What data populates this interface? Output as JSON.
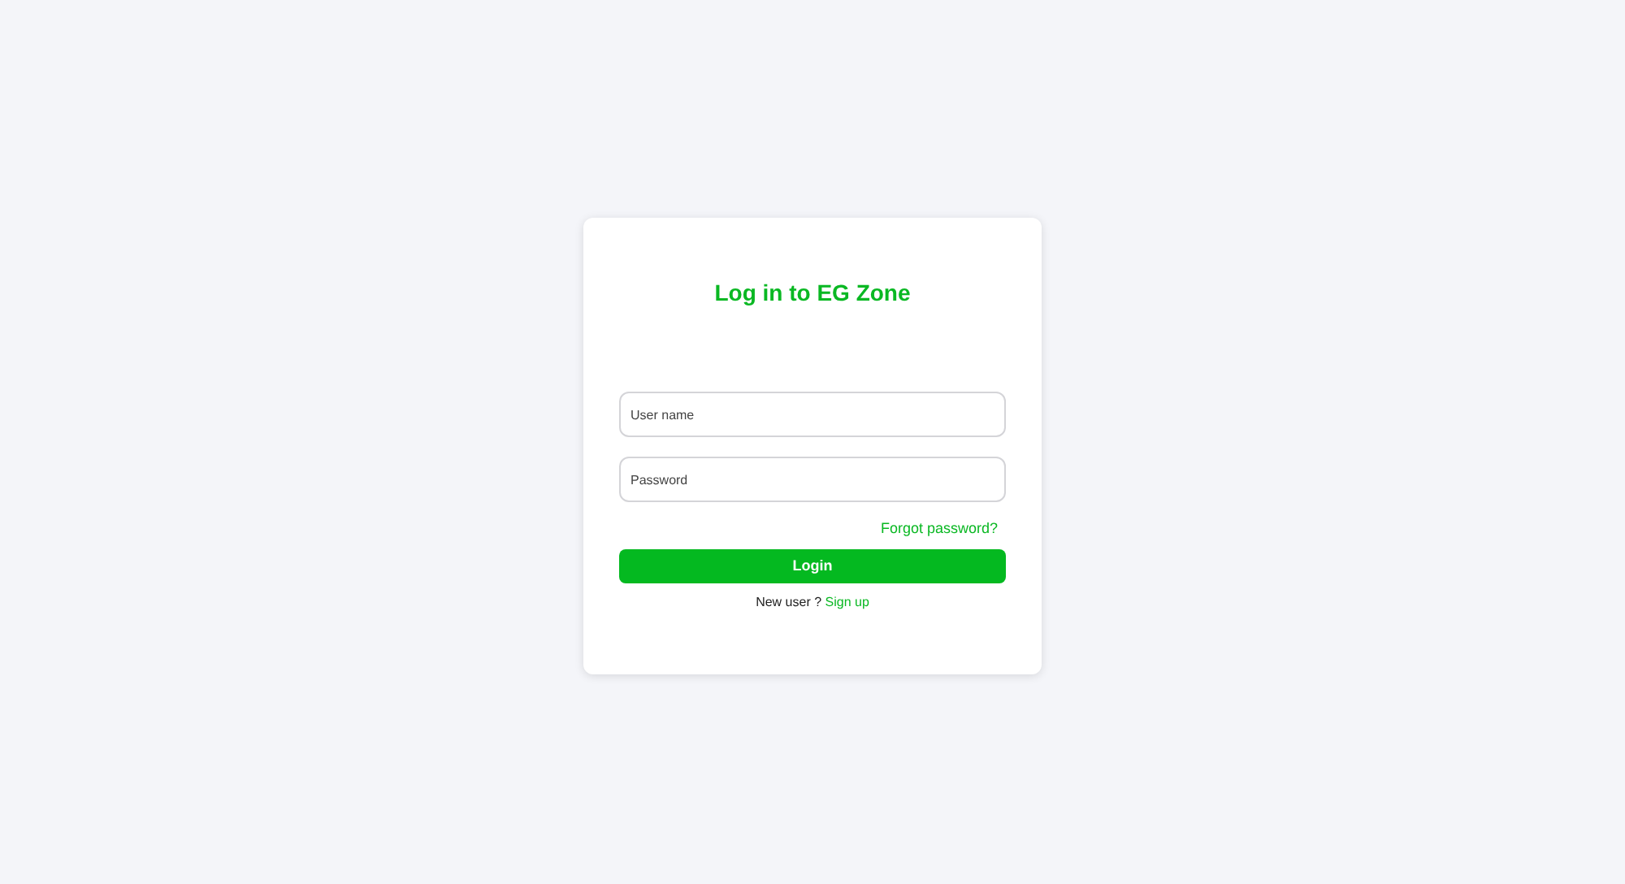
{
  "card": {
    "title": "Log in to EG Zone",
    "fields": [
      {
        "placeholder": "User name"
      },
      {
        "placeholder": "Password"
      }
    ],
    "forgot_link": "Forgot password?",
    "login_button": "Login",
    "signup_prompt": {
      "text": "New user ? ",
      "link": "Sign up"
    }
  }
}
